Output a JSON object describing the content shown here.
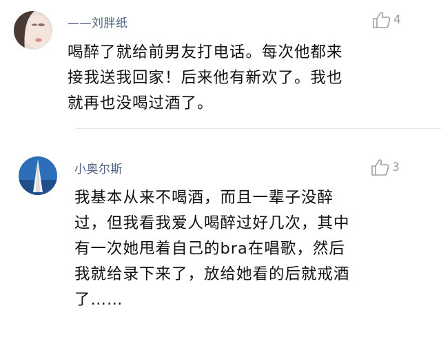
{
  "comments": [
    {
      "username": "——刘胖纸",
      "likes": "4",
      "text": "喝醉了就给前男友打电话。每次他都来\n接我送我回家！后来他有新欢了。我也\n就再也没喝过酒了。"
    },
    {
      "username": "小奥尔斯",
      "likes": "3",
      "text": "我基本从来不喝酒，而且一辈子没醉\n过，但我看我爱人喝醉过好几次，其中\n有一次她甩着自己的bra在唱歌，然后\n我就给录下来了，放给她看的后就戒酒\n了……"
    }
  ]
}
